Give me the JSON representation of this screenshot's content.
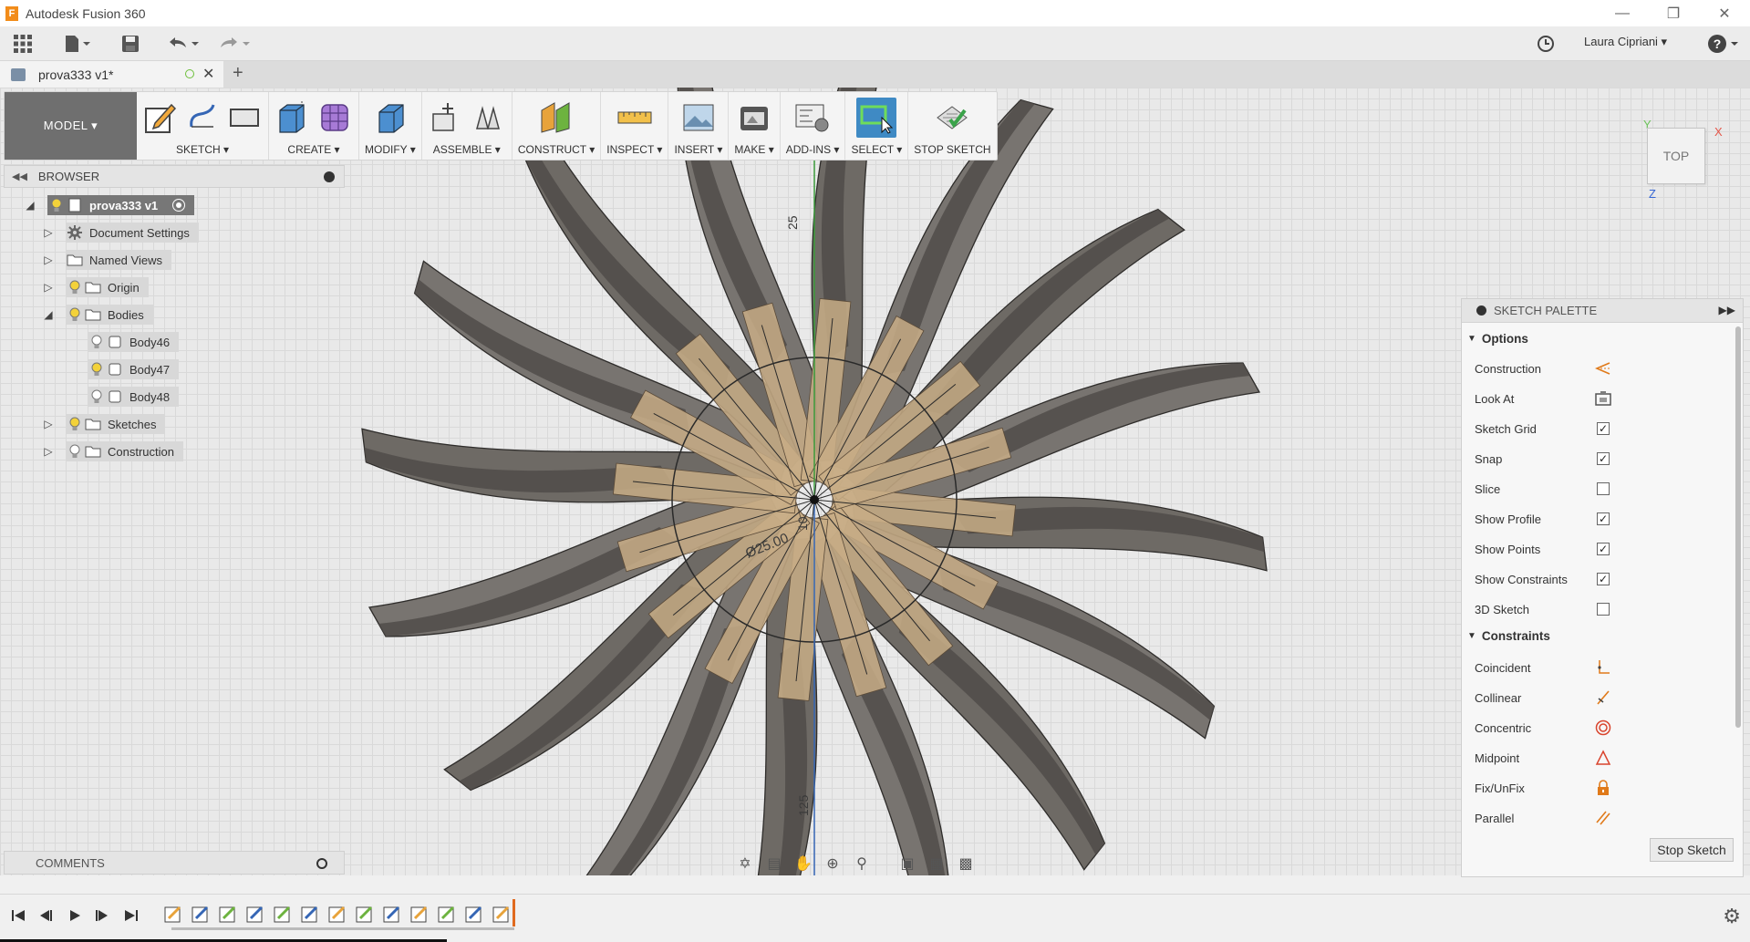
{
  "window": {
    "title": "Autodesk Fusion 360",
    "app_logo": "F"
  },
  "quick_access": {
    "user_name": "Laura Cipriani ▾",
    "help": "?"
  },
  "document_tab": {
    "label": "prova333 v1*"
  },
  "toolbar": {
    "workspace": "MODEL ▾",
    "groups": [
      {
        "label": "SKETCH ▾"
      },
      {
        "label": "CREATE ▾"
      },
      {
        "label": "MODIFY ▾"
      },
      {
        "label": "ASSEMBLE ▾"
      },
      {
        "label": "CONSTRUCT ▾"
      },
      {
        "label": "INSPECT ▾"
      },
      {
        "label": "INSERT ▾"
      },
      {
        "label": "MAKE ▾"
      },
      {
        "label": "ADD-INS ▾"
      },
      {
        "label": "SELECT ▾"
      },
      {
        "label": "STOP SKETCH"
      }
    ]
  },
  "browser": {
    "title": "BROWSER",
    "items": [
      {
        "label": "prova333 v1",
        "icon": "document-icon"
      },
      {
        "label": "Document Settings",
        "icon": "gear-icon"
      },
      {
        "label": "Named Views",
        "icon": "folder-icon"
      },
      {
        "label": "Origin",
        "icon": "folder-icon"
      },
      {
        "label": "Bodies",
        "icon": "folder-icon"
      },
      {
        "label": "Body46",
        "icon": "body-icon"
      },
      {
        "label": "Body47",
        "icon": "body-icon"
      },
      {
        "label": "Body48",
        "icon": "body-icon"
      },
      {
        "label": "Sketches",
        "icon": "folder-icon"
      },
      {
        "label": "Construction",
        "icon": "folder-icon"
      }
    ]
  },
  "comments": {
    "title": "COMMENTS"
  },
  "viewcube": {
    "face": "TOP",
    "axis_x": "X",
    "axis_y": "Y",
    "axis_z": "Z"
  },
  "viewport": {
    "dimension_diameter": "Ø25.00",
    "dimension_top": "25",
    "dimension_mid": "10",
    "dimension_bottom": "125"
  },
  "sketch_palette": {
    "title": "SKETCH PALETTE",
    "options_title": "Options",
    "options": [
      {
        "label": "Construction",
        "control": "construction-icon"
      },
      {
        "label": "Look At",
        "control": "look-at-icon"
      },
      {
        "label": "Sketch Grid",
        "checked": true
      },
      {
        "label": "Snap",
        "checked": true
      },
      {
        "label": "Slice",
        "checked": false
      },
      {
        "label": "Show Profile",
        "checked": true
      },
      {
        "label": "Show Points",
        "checked": true
      },
      {
        "label": "Show Constraints",
        "checked": true
      },
      {
        "label": "3D Sketch",
        "checked": false
      }
    ],
    "constraints_title": "Constraints",
    "constraints": [
      {
        "label": "Coincident",
        "icon": "coincident-icon"
      },
      {
        "label": "Collinear",
        "icon": "collinear-icon"
      },
      {
        "label": "Concentric",
        "icon": "concentric-icon"
      },
      {
        "label": "Midpoint",
        "icon": "midpoint-icon"
      },
      {
        "label": "Fix/UnFix",
        "icon": "lock-icon"
      },
      {
        "label": "Parallel",
        "icon": "parallel-icon"
      }
    ],
    "stop_button": "Stop Sketch"
  },
  "colors": {
    "accent_blue": "#3f8ac4",
    "model_gray": "#6b6b6b",
    "profile_tan": "#c8ad86",
    "timeline_marker": "#e06a1f"
  }
}
